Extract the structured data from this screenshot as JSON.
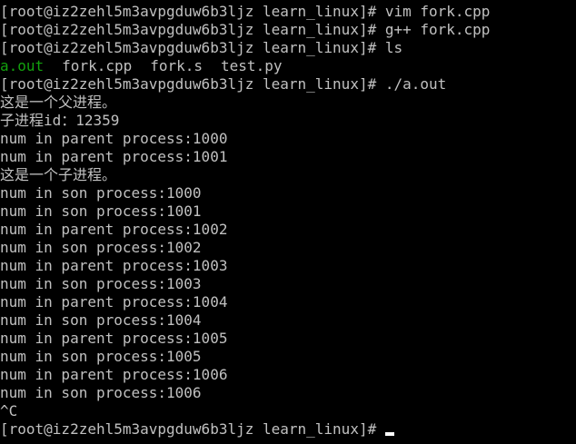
{
  "prompt": "[root@iz2zehl5m3avpgduw6b3ljz learn_linux]# ",
  "commands": [
    "vim fork.cpp",
    "g++ fork.cpp",
    "ls"
  ],
  "ls_output": {
    "a_out": "a.out",
    "fork_cpp": "fork.cpp",
    "fork_s": "fork.s",
    "test_py": "test.py"
  },
  "run_command": "./a.out",
  "output_lines": [
    "这是一个父进程。",
    "子进程id：12359",
    "num in parent process:1000",
    "num in parent process:1001",
    "这是一个子进程。",
    "num in son process:1000",
    "num in son process:1001",
    "num in parent process:1002",
    "num in son process:1002",
    "num in parent process:1003",
    "num in son process:1003",
    "num in parent process:1004",
    "num in son process:1004",
    "num in parent process:1005",
    "num in son process:1005",
    "num in parent process:1006",
    "num in son process:1006",
    "^C"
  ],
  "colors": {
    "background": "#000000",
    "text": "#c0c0c0",
    "executable": "#13a10e",
    "cursor": "#ffffff"
  }
}
